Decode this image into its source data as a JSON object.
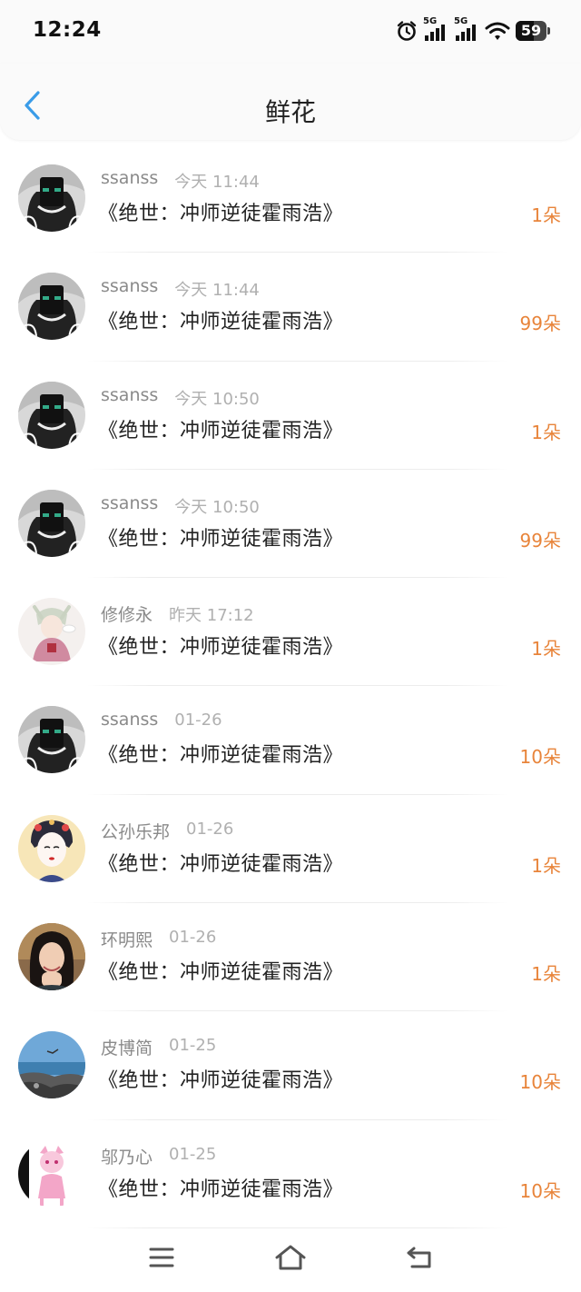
{
  "status_bar": {
    "time": "12:24",
    "network_1": "5G",
    "network_2": "5G",
    "battery": "59"
  },
  "header": {
    "title": "鲜花",
    "back_icon": "chevron-left-icon"
  },
  "colors": {
    "accent": "#3a9ce8",
    "amount": "#e8843a"
  },
  "gifts": [
    {
      "name": "ssanss",
      "time": "今天 11:44",
      "book": "《绝世：冲师逆徒霍雨浩》",
      "amount": "1朵",
      "avatar": "ssanss"
    },
    {
      "name": "ssanss",
      "time": "今天 11:44",
      "book": "《绝世：冲师逆徒霍雨浩》",
      "amount": "99朵",
      "avatar": "ssanss"
    },
    {
      "name": "ssanss",
      "time": "今天 10:50",
      "book": "《绝世：冲师逆徒霍雨浩》",
      "amount": "1朵",
      "avatar": "ssanss"
    },
    {
      "name": "ssanss",
      "time": "今天 10:50",
      "book": "《绝世：冲师逆徒霍雨浩》",
      "amount": "99朵",
      "avatar": "ssanss"
    },
    {
      "name": "修修永",
      "time": "昨天 17:12",
      "book": "《绝世：冲师逆徒霍雨浩》",
      "amount": "1朵",
      "avatar": "anime-pink"
    },
    {
      "name": "ssanss",
      "time": "01-26",
      "book": "《绝世：冲师逆徒霍雨浩》",
      "amount": "10朵",
      "avatar": "ssanss"
    },
    {
      "name": "公孙乐邦",
      "time": "01-26",
      "book": "《绝世：冲师逆徒霍雨浩》",
      "amount": "1朵",
      "avatar": "geisha"
    },
    {
      "name": "环明熙",
      "time": "01-26",
      "book": "《绝世：冲师逆徒霍雨浩》",
      "amount": "1朵",
      "avatar": "portrait"
    },
    {
      "name": "皮博简",
      "time": "01-25",
      "book": "《绝世：冲师逆徒霍雨浩》",
      "amount": "10朵",
      "avatar": "seascape"
    },
    {
      "name": "邬乃心",
      "time": "01-25",
      "book": "《绝世：冲师逆徒霍雨浩》",
      "amount": "10朵",
      "avatar": "pink-cat"
    }
  ],
  "bottom_nav": {
    "menu_icon": "menu-icon",
    "home_icon": "home-icon",
    "back_icon": "back-icon"
  }
}
